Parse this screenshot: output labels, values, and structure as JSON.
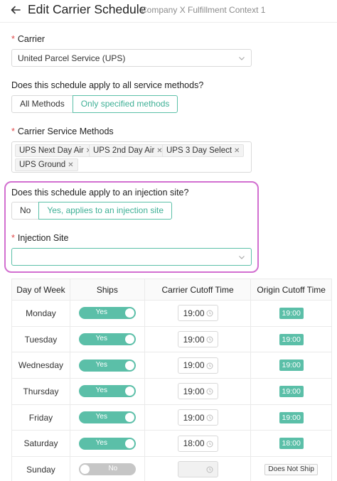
{
  "header": {
    "title": "Edit Carrier Schedule",
    "subtitle": "Company X Fulfillment Context 1"
  },
  "carrier": {
    "label": "Carrier",
    "value": "United Parcel Service (UPS)"
  },
  "apply_all": {
    "question": "Does this schedule apply to all service methods?",
    "options": [
      "All Methods",
      "Only specified methods"
    ],
    "selected": "Only specified methods"
  },
  "service_methods": {
    "label": "Carrier Service Methods",
    "tags": [
      "UPS Next Day Air",
      "UPS 2nd Day Air",
      "UPS 3 Day Select",
      "UPS Ground"
    ]
  },
  "injection": {
    "question": "Does this schedule apply to an injection site?",
    "options": [
      "No",
      "Yes, applies to an injection site"
    ],
    "selected": "Yes, applies to an injection site",
    "site_label": "Injection Site",
    "site_value": ""
  },
  "schedule": {
    "columns": [
      "Day of Week",
      "Ships",
      "Carrier Cutoff Time",
      "Origin Cutoff Time"
    ],
    "rows": [
      {
        "day": "Monday",
        "ships": "Yes",
        "carrier_cutoff": "19:00",
        "origin_cutoff": "19:00"
      },
      {
        "day": "Tuesday",
        "ships": "Yes",
        "carrier_cutoff": "19:00",
        "origin_cutoff": "19:00"
      },
      {
        "day": "Wednesday",
        "ships": "Yes",
        "carrier_cutoff": "19:00",
        "origin_cutoff": "19:00"
      },
      {
        "day": "Thursday",
        "ships": "Yes",
        "carrier_cutoff": "19:00",
        "origin_cutoff": "19:00"
      },
      {
        "day": "Friday",
        "ships": "Yes",
        "carrier_cutoff": "19:00",
        "origin_cutoff": "19:00"
      },
      {
        "day": "Saturday",
        "ships": "Yes",
        "carrier_cutoff": "18:00",
        "origin_cutoff": "18:00"
      },
      {
        "day": "Sunday",
        "ships": "No",
        "carrier_cutoff": "",
        "origin_cutoff": "Does Not Ship"
      }
    ]
  },
  "colors": {
    "accent": "#5bbfa8",
    "highlight_border": "#d26fd0",
    "required": "#e0494a"
  }
}
